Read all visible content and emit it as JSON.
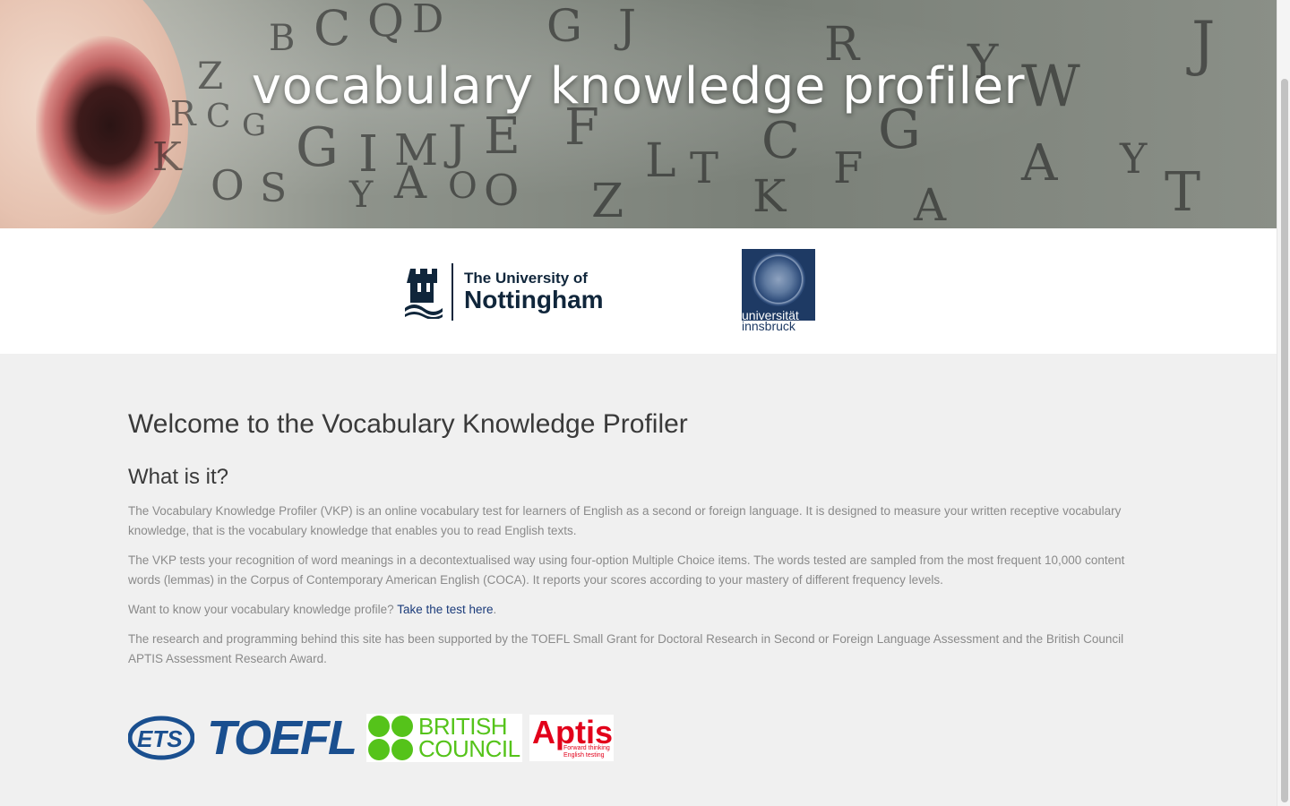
{
  "hero": {
    "title": "vocabulary knowledge profiler"
  },
  "logos": {
    "nottingham": {
      "line1": "The University of",
      "line2": "Nottingham"
    },
    "innsbruck": {
      "line1": "universität",
      "line2": "innsbruck"
    }
  },
  "main": {
    "heading": "Welcome to the Vocabulary Knowledge Profiler",
    "subheading": "What is it?",
    "paragraph1": "The Vocabulary Knowledge Profiler (VKP) is an online vocabulary test for learners of English as a second or foreign language. It is designed to measure your written receptive vocabulary knowledge, that is the vocabulary knowledge that enables you to read English texts.",
    "paragraph2": "The VKP tests your recognition of word meanings in a decontextualised way using four-option Multiple Choice items. The words tested are sampled from the most frequent 10,000 content words (lemmas) in the Corpus of Contemporary American English (COCA). It reports your scores according to your mastery of different frequency levels.",
    "cta_prefix": "Want to know your vocabulary knowledge profile?",
    "cta_link": "Take the test here",
    "cta_suffix": ".",
    "paragraph4": "The research and programming behind this site has been supported by the TOEFL Small Grant for Doctoral Research in Second or Foreign Language Assessment and the British Council APTIS Assessment Research Award."
  },
  "sponsors": {
    "ets": "ETS",
    "toefl": "TOEFL",
    "british_council_line1": "BRITISH",
    "british_council_line2": "COUNCIL",
    "aptis": "Aptis",
    "aptis_tagline_line1": "Forward thinking",
    "aptis_tagline_line2": "English testing"
  },
  "colors": {
    "link": "#1b3b7a",
    "nottingham_blue": "#10263b",
    "toefl_blue": "#1a4f8f",
    "british_council_green": "#55c31a",
    "aptis_red": "#e2001a",
    "innsbruck_blue": "#1e3a64"
  }
}
